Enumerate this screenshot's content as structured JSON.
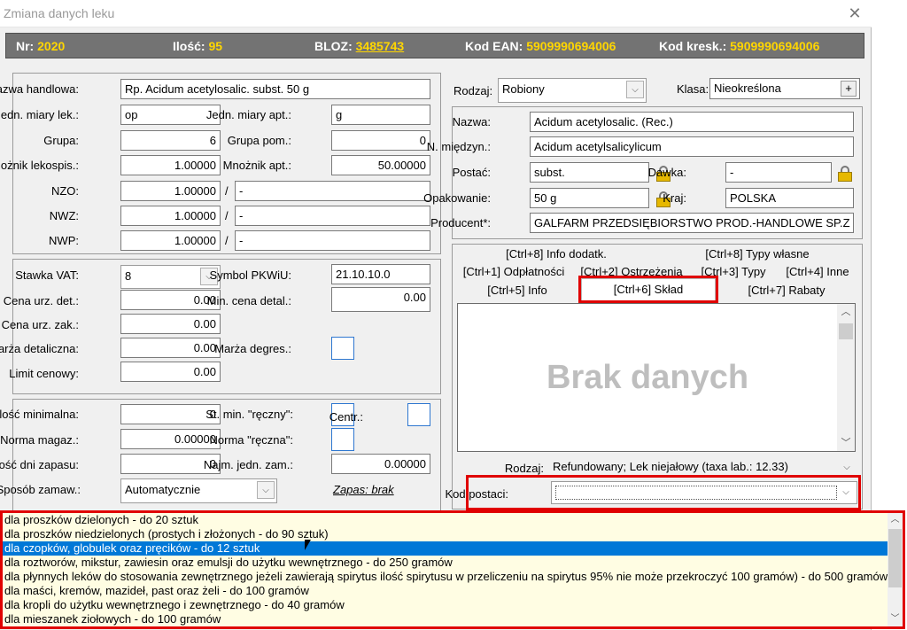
{
  "window": {
    "title": "Zmiana danych leku"
  },
  "header": {
    "nr_label": "Nr:",
    "nr_value": "2020",
    "ilosc_label": "Ilość:",
    "ilosc_value": "95",
    "bloz_label": "BLOZ:",
    "bloz_value": "3485743",
    "ean_label": "Kod EAN:",
    "ean_value": "5909990694006",
    "kresk_label": "Kod kresk.:",
    "kresk_value": "5909990694006"
  },
  "left_top": {
    "nazwa_label": "Nazwa handlowa:",
    "nazwa_value": "Rp. Acidum acetylosalic. subst. 50 g",
    "jm_lek_label": "Jedn. miary lek.:",
    "jm_lek_value": "op",
    "jm_apt_label": "Jedn. miary apt.:",
    "jm_apt_value": "g",
    "grupa_label": "Grupa:",
    "grupa_value": "6",
    "grupa_pom_label": "Grupa pom.:",
    "grupa_pom_value": "0",
    "mnoznik_lek_label": "Mnożnik lekospis.:",
    "mnoznik_lek_value": "1.00000",
    "mnoznik_apt_label": "Mnożnik apt.:",
    "mnoznik_apt_value": "50.00000",
    "nzo_label": "NZO:",
    "nzo_value": "1.00000",
    "nzo_extra": "-",
    "nwz_label": "NWZ:",
    "nwz_value": "1.00000",
    "nwz_extra": "-",
    "nwp_label": "NWP:",
    "nwp_value": "1.00000",
    "nwp_extra": "-",
    "slash": "/"
  },
  "left_mid": {
    "vat_label": "Stawka VAT:",
    "vat_value": "8",
    "pkwiu_label": "Symbol PKWiU:",
    "pkwiu_value": "21.10.10.0",
    "cena_det_label": "Cena urz. det.:",
    "cena_det_value": "0.00",
    "min_cena_label": "Min. cena detal.:",
    "min_cena_value": "0.00",
    "cena_zak_label": "Cena urz. zak.:",
    "cena_zak_value": "0.00",
    "marza_det_label": "Marża detaliczna:",
    "marza_det_value": "0.00",
    "marza_deg_label": "Marża degres.:",
    "limit_label": "Limit cenowy:",
    "limit_value": "0.00"
  },
  "left_bot": {
    "ilosc_min_label": "Ilość minimalna:",
    "ilosc_min_value": "0",
    "st_min_label": "St. min. \"ręczny\":",
    "centr_label": "Centr.:",
    "norma_mag_label": "Norma magaz.:",
    "norma_mag_value": "0.00000",
    "norma_r_label": "Norma \"ręczna\":",
    "dni_label": "Ilość dni zapasu:",
    "dni_value": "0",
    "najm_label": "Najm. jedn. zam.:",
    "najm_value": "0.00000",
    "sposob_label": "Sposób zamaw.:",
    "sposob_value": "Automatycznie",
    "zapas_link": "Zapas: brak"
  },
  "right_top": {
    "rodzaj_label": "Rodzaj:",
    "rodzaj_value": "Robiony",
    "klasa_label": "Klasa:",
    "klasa_value": "Nieokreślona",
    "klasa_btn": "+",
    "nazwa_label": "Nazwa:",
    "nazwa_value": "Acidum acetylosalic. (Rec.)",
    "nmiedzyn_label": "N. międzyn.:",
    "nmiedzyn_value": "Acidum acetylsalicylicum",
    "postac_label": "Postać:",
    "postac_value": "subst.",
    "dawka_label": "Dawka:",
    "dawka_value": "-",
    "opak_label": "Opakowanie:",
    "opak_value": "50 g",
    "kraj_label": "Kraj:",
    "kraj_value": "POLSKA",
    "producent_label": "Producent*:",
    "producent_value": "GALFARM PRZEDSIĘBIORSTWO PROD.-HANDLOWE SP.Z O.O."
  },
  "tabs": {
    "row1": [
      "[Ctrl+8] Info dodatk.",
      "[Ctrl+8] Typy własne"
    ],
    "row2": [
      "[Ctrl+1] Odpłatności",
      "[Ctrl+2] Ostrzeżenia",
      "[Ctrl+3] Typy",
      "[Ctrl+4] Inne"
    ],
    "row3": [
      "[Ctrl+5] Info",
      "[Ctrl+6] Skład",
      "[Ctrl+7] Rabaty"
    ]
  },
  "content": {
    "empty_text": "Brak danych"
  },
  "bottom_right": {
    "rodzaj_label": "Rodzaj:",
    "rodzaj_value": "Refundowany; Lek niejałowy (taxa lab.: 12.33)",
    "kod_postaci_label": "Kod postaci:",
    "kod_postaci_value": ""
  },
  "dropdown": {
    "options": [
      "dla proszków dzielonych - do 20 sztuk",
      "dla proszków niedzielonych (prostych i złożonych - do 90 sztuk)",
      "dla czopków, globulek oraz pręcików - do 12 sztuk",
      "dla roztworów, mikstur, zawiesin oraz emulsji do użytku wewnętrznego - do 250 gramów",
      "dla płynnych leków do stosowania zewnętrznego jeżeli zawierają spirytus ilość spirytusu w przeliczeniu na spirytus 95% nie może przekroczyć 100 gramów) - do 500 gramów",
      "dla maści, kremów, mazideł, past oraz żeli - do 100 gramów",
      "dla kropli do użytku wewnętrznego i zewnętrznego - do 40 gramów",
      "dla mieszanek ziołowych - do 100 gramów"
    ],
    "selected_index": 2
  },
  "colors": {
    "accent_yellow": "#ffd600",
    "highlight_red": "#e00000",
    "selection_blue": "#0078d7"
  }
}
